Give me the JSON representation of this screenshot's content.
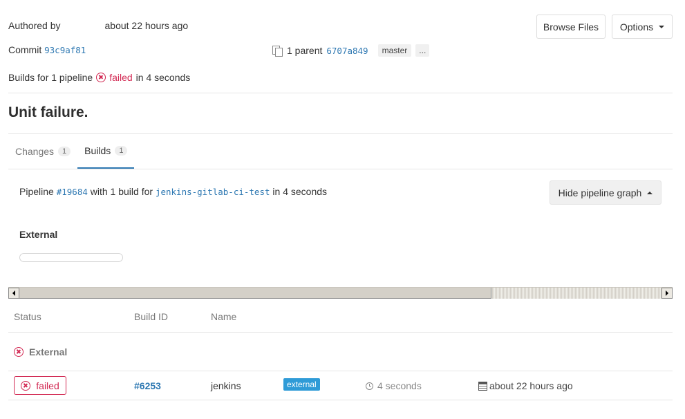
{
  "commit_header": {
    "authored_by_label": "Authored by",
    "authored_time": "about 22 hours ago",
    "commit_label": "Commit",
    "commit_sha": "93c9af81",
    "parent_label": "1 parent",
    "parent_sha": "6707a849",
    "branch": "master",
    "more_refs": "..."
  },
  "actions": {
    "browse_files": "Browse Files",
    "options": "Options"
  },
  "builds_summary": {
    "prefix": "Builds for 1 pipeline",
    "status": "failed",
    "suffix": "in 4 seconds"
  },
  "commit_title": "Unit failure.",
  "tabs": [
    {
      "label": "Changes",
      "count": "1"
    },
    {
      "label": "Builds",
      "count": "1"
    }
  ],
  "pipeline": {
    "prefix": "Pipeline",
    "id": "#19684",
    "middle": "with 1 build for",
    "ref": "jenkins-gitlab-ci-test",
    "suffix": "in 4 seconds",
    "hide_graph_button": "Hide pipeline graph",
    "stage_name": "External"
  },
  "table": {
    "headers": {
      "status": "Status",
      "build_id": "Build ID",
      "name": "Name"
    },
    "group_name": "External",
    "rows": [
      {
        "status": "failed",
        "build_id": "#6253",
        "name": "jenkins",
        "tag": "external",
        "duration": "4 seconds",
        "finished": "about 22 hours ago"
      }
    ]
  },
  "colors": {
    "failed": "#d22852",
    "link": "#2e78b2",
    "external_tag": "#2f9bd7"
  }
}
